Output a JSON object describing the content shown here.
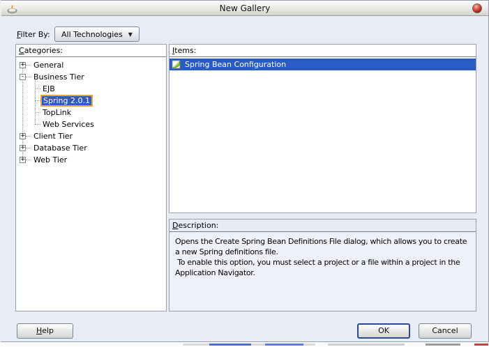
{
  "window": {
    "title": "New Gallery"
  },
  "filter": {
    "label_mnemonic": "F",
    "label_rest": "ilter By:",
    "dropdown_value": "All Technologies",
    "dropdown_arrow": "▼"
  },
  "categories": {
    "header_mnemonic": "C",
    "header_rest": "ategories:",
    "tree": [
      {
        "label": "General",
        "expander": "+",
        "level": 0,
        "selected": false
      },
      {
        "label": "Business Tier",
        "expander": "-",
        "level": 0,
        "selected": false
      },
      {
        "label": "EJB",
        "expander": "",
        "level": 1,
        "selected": false
      },
      {
        "label": "Spring 2.0.1",
        "expander": "",
        "level": 1,
        "selected": true
      },
      {
        "label": "TopLink",
        "expander": "",
        "level": 1,
        "selected": false
      },
      {
        "label": "Web Services",
        "expander": "",
        "level": 1,
        "selected": false
      },
      {
        "label": "Client Tier",
        "expander": "+",
        "level": 0,
        "selected": false
      },
      {
        "label": "Database Tier",
        "expander": "+",
        "level": 0,
        "selected": false
      },
      {
        "label": "Web Tier",
        "expander": "+",
        "level": 0,
        "selected": false
      }
    ]
  },
  "items": {
    "header_mnemonic": "I",
    "header_rest": "tems:",
    "rows": [
      {
        "label": "Spring Bean Configuration",
        "icon": "spring-bean-file-icon",
        "selected": true
      }
    ]
  },
  "description": {
    "header_mnemonic": "D",
    "header_rest": "escription:",
    "body": "Opens the Create Spring Bean Definitions File dialog, which allows you to create a new Spring definitions file.\n To enable this option, you must select a project or a file within a project in the Application Navigator."
  },
  "buttons": {
    "help_mnemonic": "H",
    "help_rest": "elp",
    "ok": "OK",
    "cancel": "Cancel"
  },
  "colors": {
    "selection_blue": "#2a5cc4",
    "selection_focus_ring": "#e8a33d",
    "dialog_background": "#e8ecf7",
    "close_orb_red": "#d6493a"
  }
}
